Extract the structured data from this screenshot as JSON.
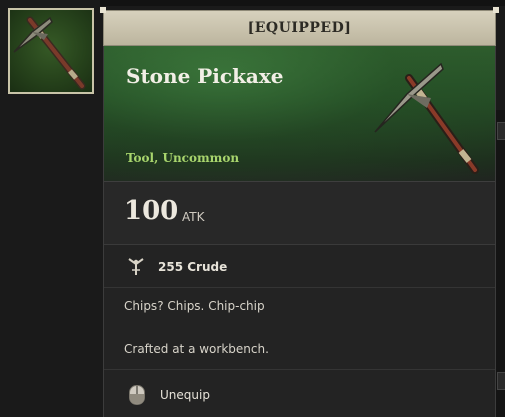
{
  "banner": {
    "label": "[EQUIPPED]"
  },
  "item": {
    "name": "Stone Pickaxe",
    "type_rarity": "Tool, Uncommon",
    "icon": "pickaxe-icon"
  },
  "stats": {
    "value": "100",
    "label": "ATK"
  },
  "cost": {
    "icon": "crude-resource-icon",
    "text": "255 Crude"
  },
  "description": {
    "line1": "Chips? Chips. Chip-chip",
    "line2": "Crafted at a workbench."
  },
  "action": {
    "icon": "mouse-button-icon",
    "label": "Unequip"
  },
  "colors": {
    "rarity": "#a8d56d",
    "header_green": "#2f5d2e",
    "banner": "#d7d1bd"
  }
}
